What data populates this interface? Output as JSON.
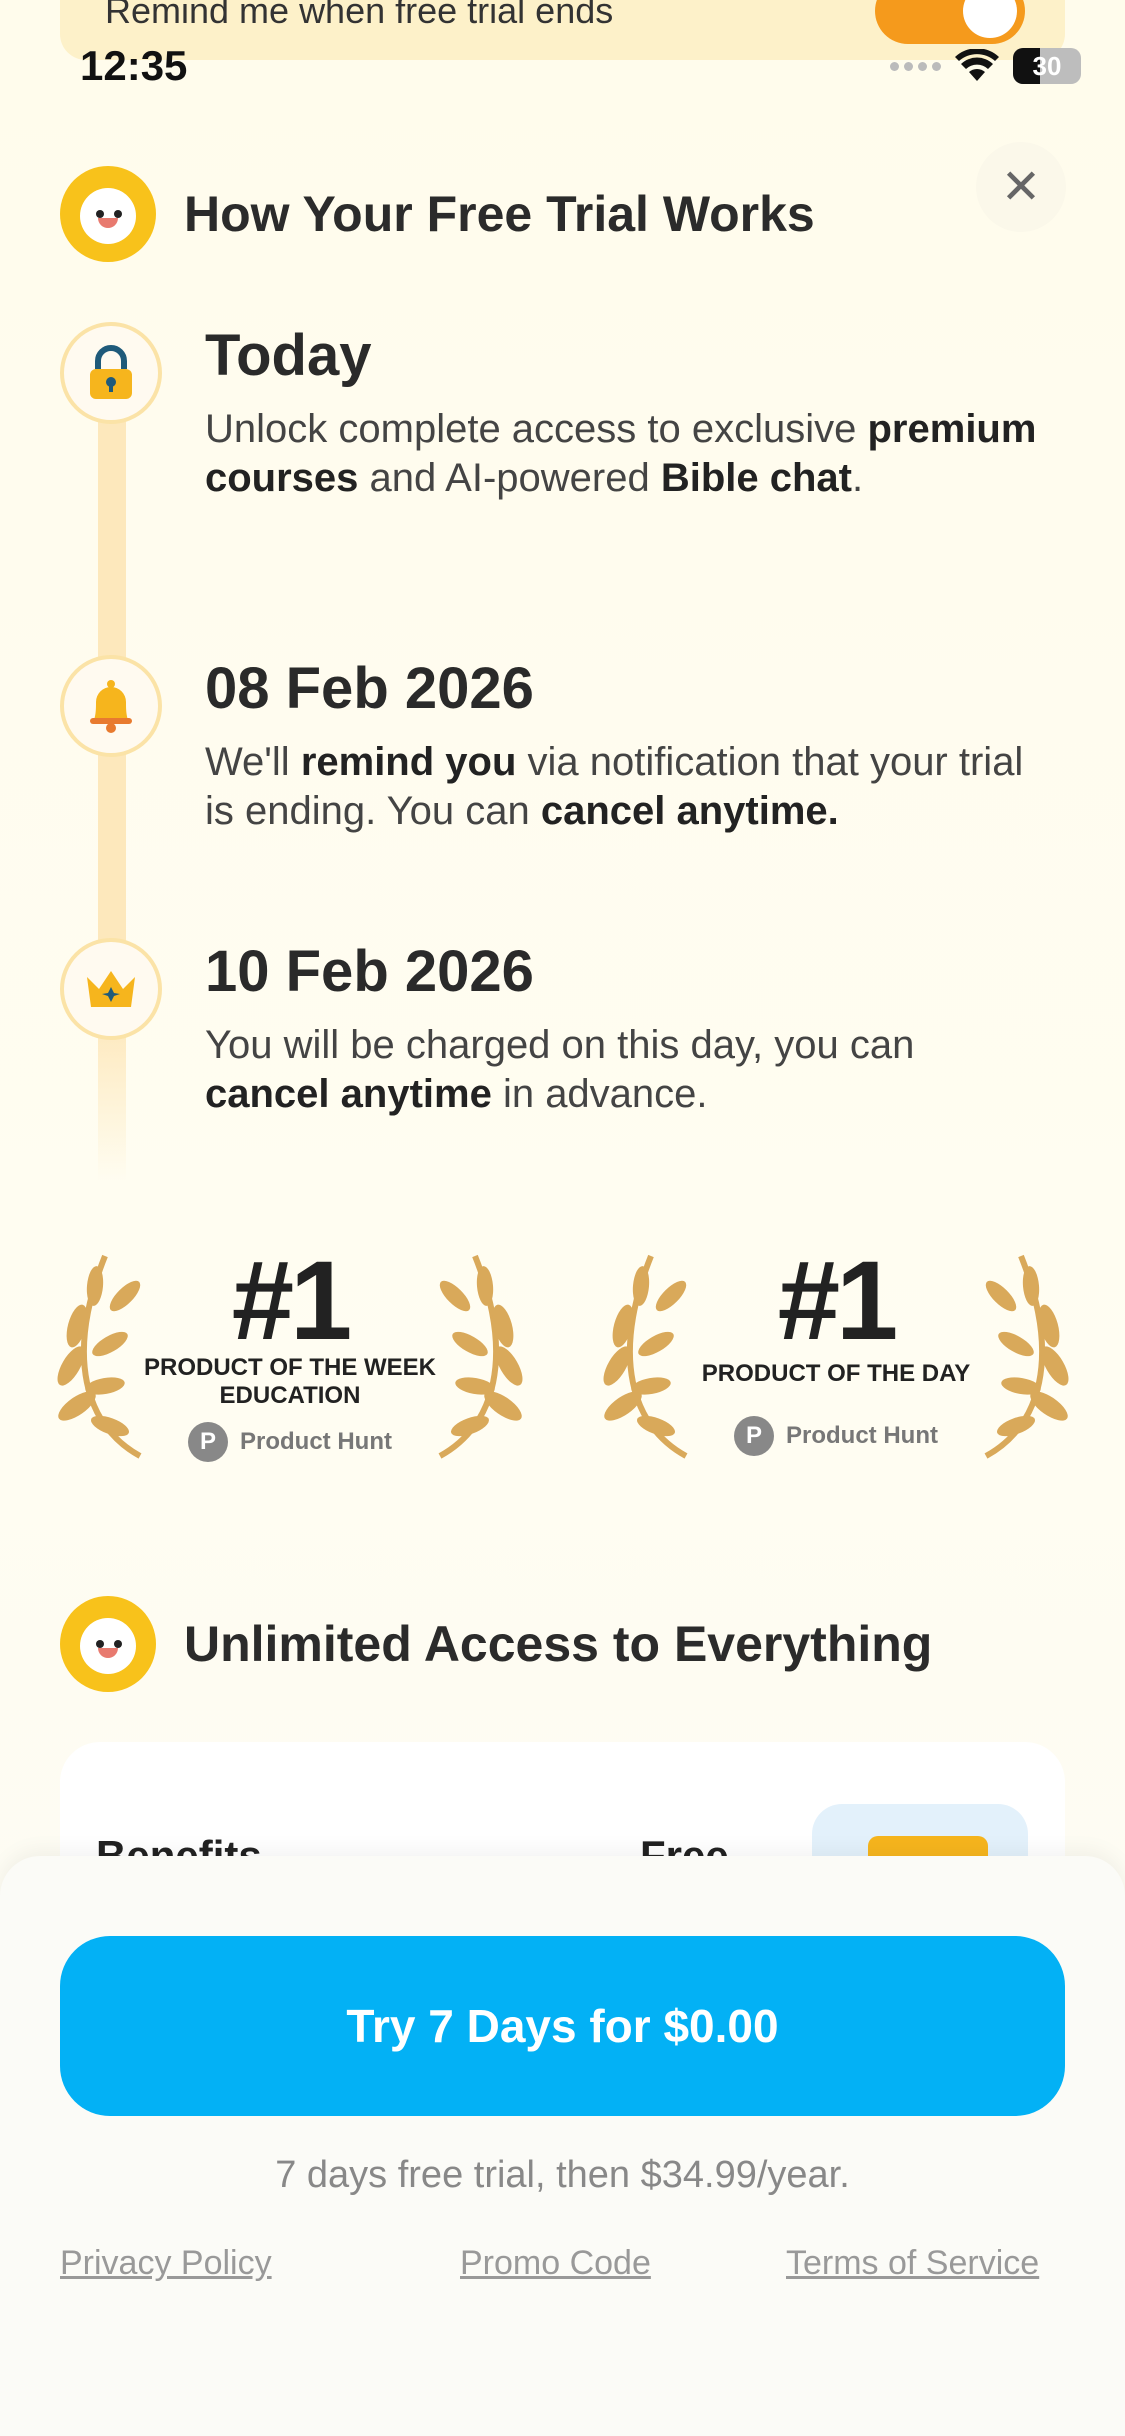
{
  "banner": {
    "text": "Remind me when free trial ends",
    "toggle_on": true
  },
  "status_bar": {
    "time": "12:35",
    "battery": "30"
  },
  "close_button": {
    "icon": "close-icon"
  },
  "trial_section": {
    "title": "How Your Free Trial Works",
    "steps": [
      {
        "title": "Today",
        "icon": "lock-icon",
        "text": [
          {
            "t": "Unlock complete access to exclusive ",
            "b": false
          },
          {
            "t": "premium courses",
            "b": true
          },
          {
            "t": " and AI-powered ",
            "b": false
          },
          {
            "t": "Bible chat",
            "b": true
          },
          {
            "t": ".",
            "b": false
          }
        ]
      },
      {
        "title": "08 Feb 2026",
        "icon": "bell-icon",
        "text": [
          {
            "t": "We'll ",
            "b": false
          },
          {
            "t": "remind you",
            "b": true
          },
          {
            "t": " via notification that your trial is ending. You can ",
            "b": false
          },
          {
            "t": "cancel anytime.",
            "b": true
          }
        ]
      },
      {
        "title": "10 Feb 2026",
        "icon": "crown-icon",
        "text": [
          {
            "t": "You will be charged on this day, you can ",
            "b": false
          },
          {
            "t": "cancel anytime",
            "b": true
          },
          {
            "t": " in advance.",
            "b": false
          }
        ]
      }
    ]
  },
  "awards": [
    {
      "rank": "#1",
      "label_line1": "PRODUCT OF THE WEEK",
      "label_line2": "EDUCATION",
      "source": "Product Hunt",
      "source_badge": "P"
    },
    {
      "rank": "#1",
      "label_line1": "PRODUCT OF THE DAY",
      "label_line2": "",
      "source": "Product Hunt",
      "source_badge": "P"
    }
  ],
  "access_section": {
    "title": "Unlimited Access to Everything",
    "table_headers": [
      "Benefits",
      "Free"
    ]
  },
  "cta": {
    "button_label": "Try 7 Days for $0.00",
    "trial_note": "7 days free trial, then $34.99/year.",
    "links": [
      "Privacy Policy",
      "Promo Code",
      "Terms of Service"
    ]
  },
  "colors": {
    "accent": "#03b1f5",
    "toggle": "#f59a1c",
    "timeline": "#fde8bc",
    "mascot": "#f8c21b",
    "laurel": "#d9a95a"
  }
}
